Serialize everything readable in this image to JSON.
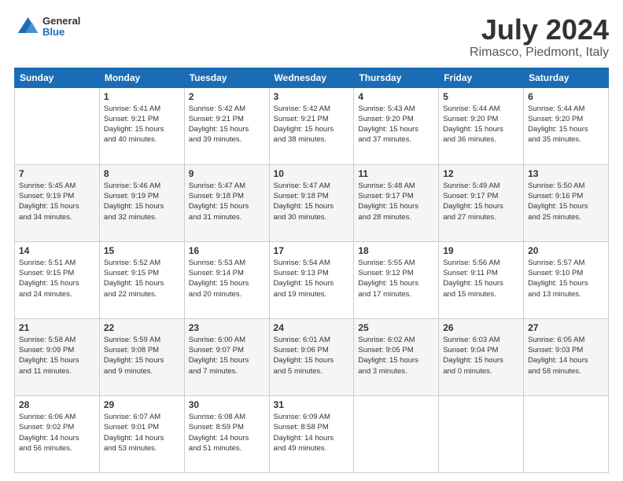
{
  "header": {
    "logo": {
      "line1": "General",
      "line2": "Blue"
    },
    "title": "July 2024",
    "subtitle": "Rimasco, Piedmont, Italy"
  },
  "days_of_week": [
    "Sunday",
    "Monday",
    "Tuesday",
    "Wednesday",
    "Thursday",
    "Friday",
    "Saturday"
  ],
  "weeks": [
    [
      {
        "day": "",
        "info": ""
      },
      {
        "day": "1",
        "info": "Sunrise: 5:41 AM\nSunset: 9:21 PM\nDaylight: 15 hours\nand 40 minutes."
      },
      {
        "day": "2",
        "info": "Sunrise: 5:42 AM\nSunset: 9:21 PM\nDaylight: 15 hours\nand 39 minutes."
      },
      {
        "day": "3",
        "info": "Sunrise: 5:42 AM\nSunset: 9:21 PM\nDaylight: 15 hours\nand 38 minutes."
      },
      {
        "day": "4",
        "info": "Sunrise: 5:43 AM\nSunset: 9:20 PM\nDaylight: 15 hours\nand 37 minutes."
      },
      {
        "day": "5",
        "info": "Sunrise: 5:44 AM\nSunset: 9:20 PM\nDaylight: 15 hours\nand 36 minutes."
      },
      {
        "day": "6",
        "info": "Sunrise: 5:44 AM\nSunset: 9:20 PM\nDaylight: 15 hours\nand 35 minutes."
      }
    ],
    [
      {
        "day": "7",
        "info": "Sunrise: 5:45 AM\nSunset: 9:19 PM\nDaylight: 15 hours\nand 34 minutes."
      },
      {
        "day": "8",
        "info": "Sunrise: 5:46 AM\nSunset: 9:19 PM\nDaylight: 15 hours\nand 32 minutes."
      },
      {
        "day": "9",
        "info": "Sunrise: 5:47 AM\nSunset: 9:18 PM\nDaylight: 15 hours\nand 31 minutes."
      },
      {
        "day": "10",
        "info": "Sunrise: 5:47 AM\nSunset: 9:18 PM\nDaylight: 15 hours\nand 30 minutes."
      },
      {
        "day": "11",
        "info": "Sunrise: 5:48 AM\nSunset: 9:17 PM\nDaylight: 15 hours\nand 28 minutes."
      },
      {
        "day": "12",
        "info": "Sunrise: 5:49 AM\nSunset: 9:17 PM\nDaylight: 15 hours\nand 27 minutes."
      },
      {
        "day": "13",
        "info": "Sunrise: 5:50 AM\nSunset: 9:16 PM\nDaylight: 15 hours\nand 25 minutes."
      }
    ],
    [
      {
        "day": "14",
        "info": "Sunrise: 5:51 AM\nSunset: 9:15 PM\nDaylight: 15 hours\nand 24 minutes."
      },
      {
        "day": "15",
        "info": "Sunrise: 5:52 AM\nSunset: 9:15 PM\nDaylight: 15 hours\nand 22 minutes."
      },
      {
        "day": "16",
        "info": "Sunrise: 5:53 AM\nSunset: 9:14 PM\nDaylight: 15 hours\nand 20 minutes."
      },
      {
        "day": "17",
        "info": "Sunrise: 5:54 AM\nSunset: 9:13 PM\nDaylight: 15 hours\nand 19 minutes."
      },
      {
        "day": "18",
        "info": "Sunrise: 5:55 AM\nSunset: 9:12 PM\nDaylight: 15 hours\nand 17 minutes."
      },
      {
        "day": "19",
        "info": "Sunrise: 5:56 AM\nSunset: 9:11 PM\nDaylight: 15 hours\nand 15 minutes."
      },
      {
        "day": "20",
        "info": "Sunrise: 5:57 AM\nSunset: 9:10 PM\nDaylight: 15 hours\nand 13 minutes."
      }
    ],
    [
      {
        "day": "21",
        "info": "Sunrise: 5:58 AM\nSunset: 9:09 PM\nDaylight: 15 hours\nand 11 minutes."
      },
      {
        "day": "22",
        "info": "Sunrise: 5:59 AM\nSunset: 9:08 PM\nDaylight: 15 hours\nand 9 minutes."
      },
      {
        "day": "23",
        "info": "Sunrise: 6:00 AM\nSunset: 9:07 PM\nDaylight: 15 hours\nand 7 minutes."
      },
      {
        "day": "24",
        "info": "Sunrise: 6:01 AM\nSunset: 9:06 PM\nDaylight: 15 hours\nand 5 minutes."
      },
      {
        "day": "25",
        "info": "Sunrise: 6:02 AM\nSunset: 9:05 PM\nDaylight: 15 hours\nand 3 minutes."
      },
      {
        "day": "26",
        "info": "Sunrise: 6:03 AM\nSunset: 9:04 PM\nDaylight: 15 hours\nand 0 minutes."
      },
      {
        "day": "27",
        "info": "Sunrise: 6:05 AM\nSunset: 9:03 PM\nDaylight: 14 hours\nand 58 minutes."
      }
    ],
    [
      {
        "day": "28",
        "info": "Sunrise: 6:06 AM\nSunset: 9:02 PM\nDaylight: 14 hours\nand 56 minutes."
      },
      {
        "day": "29",
        "info": "Sunrise: 6:07 AM\nSunset: 9:01 PM\nDaylight: 14 hours\nand 53 minutes."
      },
      {
        "day": "30",
        "info": "Sunrise: 6:08 AM\nSunset: 8:59 PM\nDaylight: 14 hours\nand 51 minutes."
      },
      {
        "day": "31",
        "info": "Sunrise: 6:09 AM\nSunset: 8:58 PM\nDaylight: 14 hours\nand 49 minutes."
      },
      {
        "day": "",
        "info": ""
      },
      {
        "day": "",
        "info": ""
      },
      {
        "day": "",
        "info": ""
      }
    ]
  ]
}
